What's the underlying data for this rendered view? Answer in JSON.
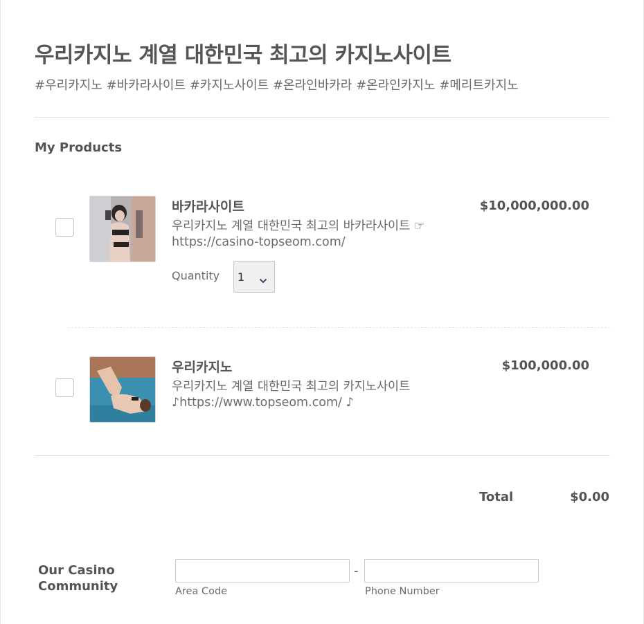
{
  "header": {
    "title": "우리카지노 계열 대한민국 최고의 카지노사이트",
    "tags": "#우리카지노 #바카라사이트 #카지노사이트 #온라인바카라 #온라인카지노 #메리트카지노"
  },
  "products": {
    "section_label": "My Products",
    "quantity_label": "Quantity",
    "items": [
      {
        "name": "바카라사이트",
        "description": "우리카지노 계열 대한민국 최고의 바카라사이트 ☞ https://casino-topseom.com/",
        "price": "$10,000,000.00",
        "quantity": "1",
        "checked": false
      },
      {
        "name": "우리카지노",
        "description": "우리카지노 계열 대한민국 최고의 카지노사이트 ♪https://www.topseom.com/ ♪",
        "price": "$100,000.00",
        "checked": false
      }
    ]
  },
  "total": {
    "label": "Total",
    "value": "$0.00"
  },
  "community": {
    "label": "Our Casino Community",
    "separator": "-",
    "area_code_label": "Area Code",
    "phone_number_label": "Phone Number",
    "area_code_value": "",
    "phone_number_value": ""
  },
  "icons": {
    "select_arrow": "chevron-down-icon"
  },
  "colors": {
    "text": "#545454",
    "muted": "#6b6b6b",
    "border": "#c4c4c4",
    "select_bg": "#f0f0f0",
    "chevron": "#3b4a66"
  }
}
